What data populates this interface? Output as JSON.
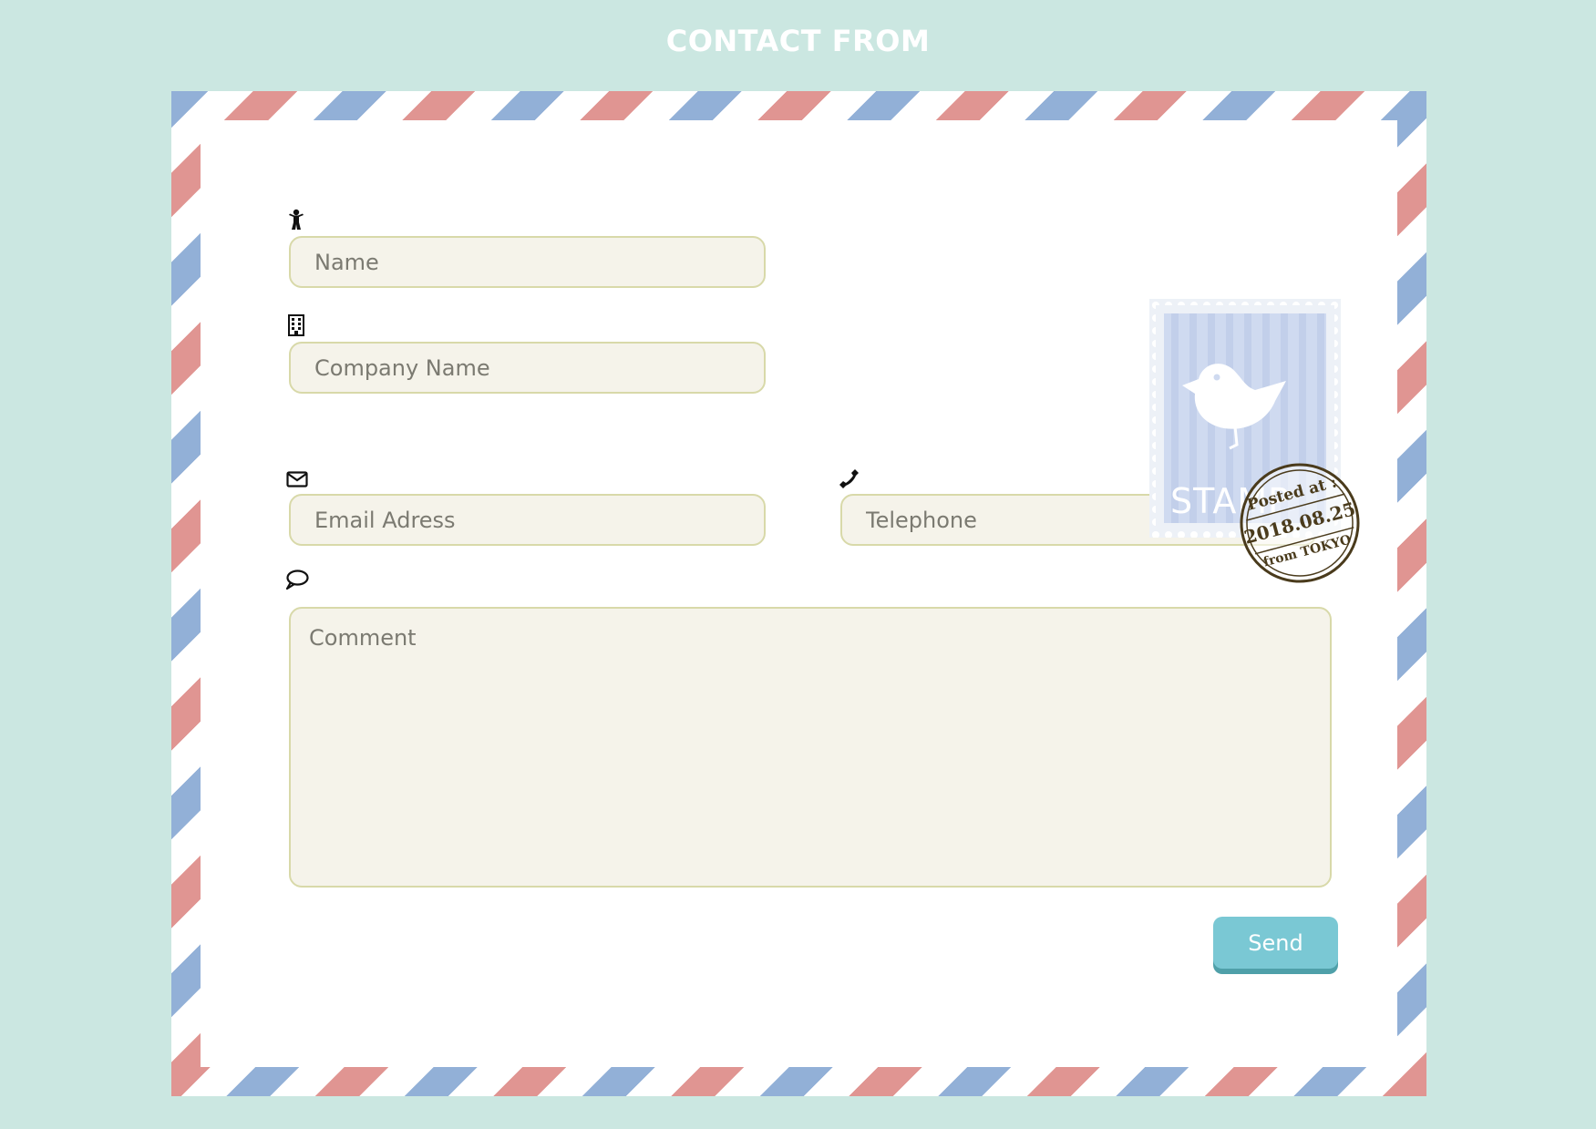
{
  "page": {
    "title": "CONTACT FROM"
  },
  "form": {
    "name": {
      "icon": "person-icon",
      "placeholder": "Name"
    },
    "company": {
      "icon": "building-icon",
      "placeholder": "Company Name"
    },
    "email": {
      "icon": "envelope-icon",
      "placeholder": "Email Adress"
    },
    "telephone": {
      "icon": "phone-icon",
      "placeholder": "Telephone"
    },
    "comment": {
      "icon": "speech-bubble-icon",
      "placeholder": "Comment"
    },
    "send_label": "Send"
  },
  "stamp": {
    "label": "STAMP",
    "icon": "bird-icon"
  },
  "postmark": {
    "line1": "Posted at :",
    "line2": "2018.08.25",
    "line3": "from TOKYO"
  },
  "colors": {
    "background": "#cbe7e1",
    "stripe_red": "#e09592",
    "stripe_blue": "#92b0d7",
    "field_fill": "#f5f3ea",
    "field_border": "#d8d9a9",
    "button": "#7ac8d4",
    "postmark": "#4a3b1c"
  }
}
